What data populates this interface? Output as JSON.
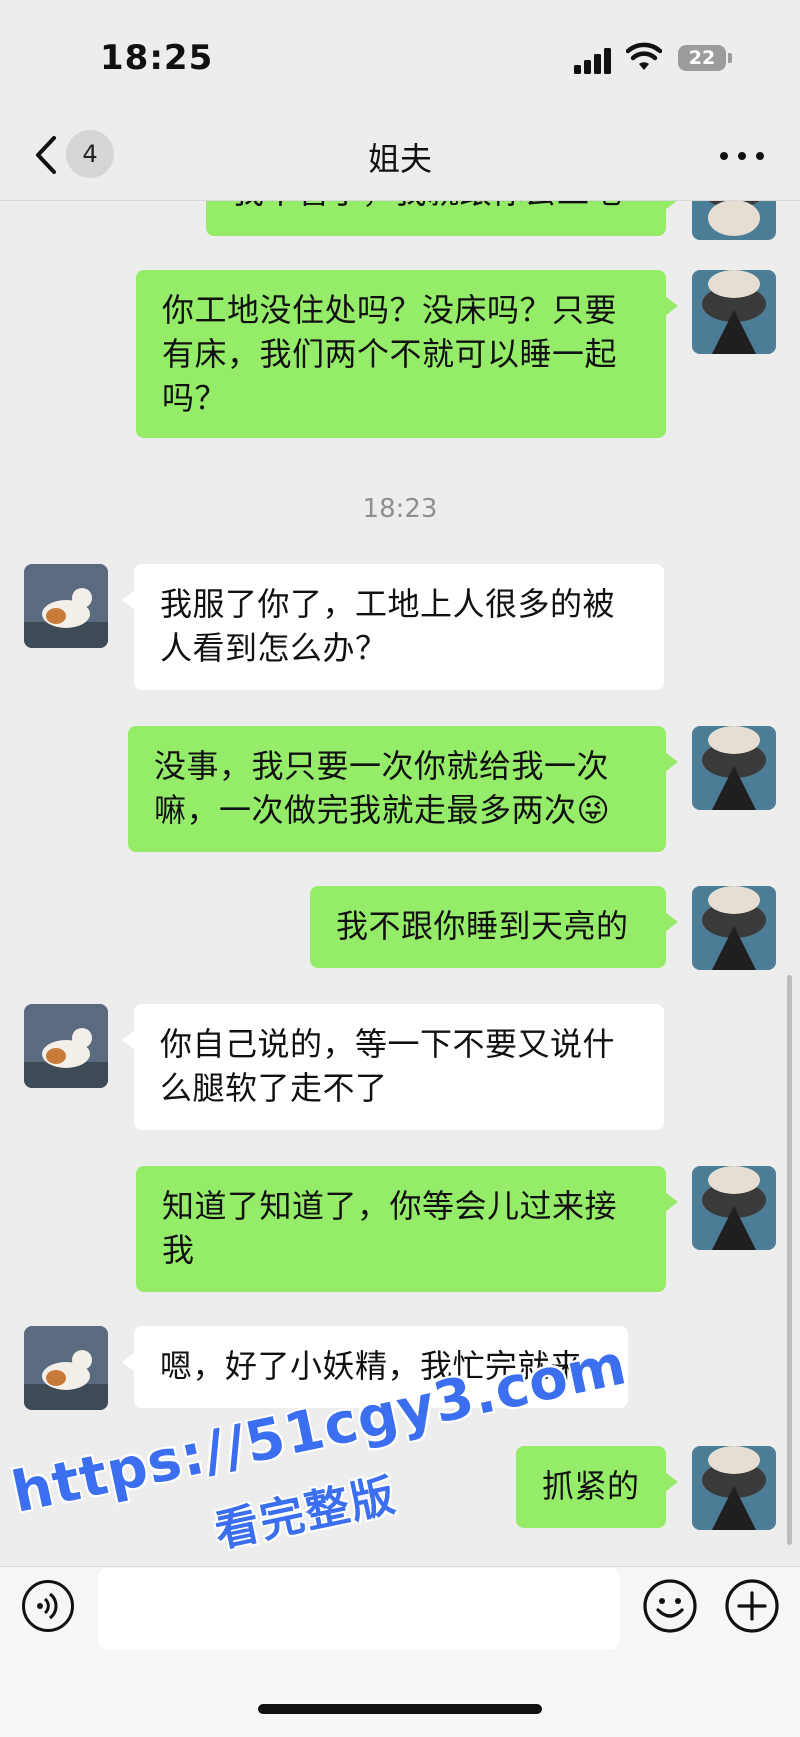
{
  "status_bar": {
    "time": "18:25",
    "battery": "22"
  },
  "nav": {
    "unread_count": "4",
    "title": "姐夫"
  },
  "chat": {
    "clipped_message": "我不管了，我就跟你去工地",
    "timestamp": "18:23",
    "messages": [
      {
        "from": "me",
        "text": "你工地没住处吗？没床吗？只要有床，我们两个不就可以睡一起吗？"
      },
      {
        "from": "them",
        "text": "我服了你了，工地上人很多的被人看到怎么办？"
      },
      {
        "from": "me",
        "text": "没事，我只要一次你就给我一次嘛，一次做完我就走最多两次😜"
      },
      {
        "from": "me",
        "text": "我不跟你睡到天亮的"
      },
      {
        "from": "them",
        "text": "你自己说的，等一下不要又说什么腿软了走不了"
      },
      {
        "from": "me",
        "text": "知道了知道了，你等会儿过来接我"
      },
      {
        "from": "them",
        "text": "嗯，好了小妖精，我忙完就来"
      },
      {
        "from": "me",
        "text": "抓紧的"
      }
    ]
  },
  "watermark": {
    "line1": "https://51cgy3.com",
    "line2": "看完整版"
  },
  "colors": {
    "my_bubble": "#95ec69",
    "their_bubble": "#ffffff",
    "background": "#ededed",
    "watermark": "#3b6ff0"
  },
  "icons": {
    "back": "chevron-left-icon",
    "more": "more-dots-icon",
    "voice": "voice-icon",
    "emoji": "emoji-icon",
    "plus": "plus-icon"
  }
}
